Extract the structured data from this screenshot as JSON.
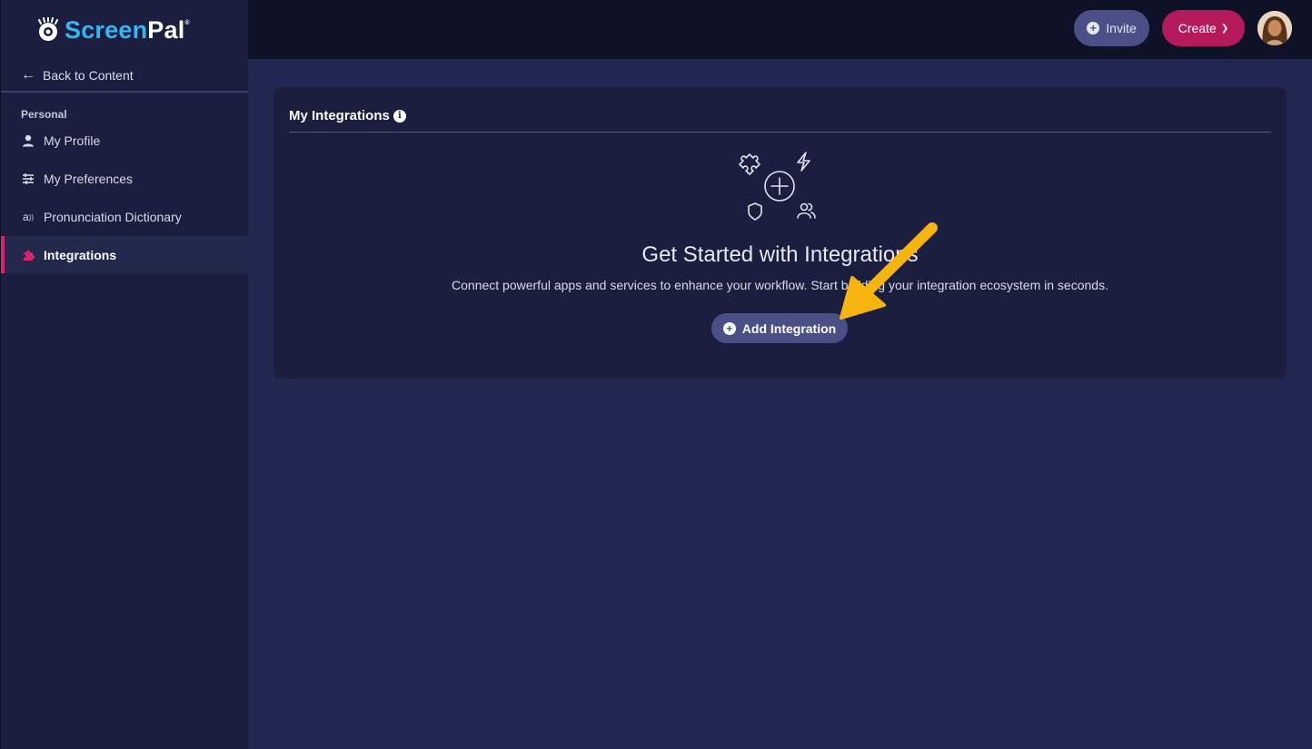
{
  "brand": {
    "name_part1": "Screen",
    "name_part2": "Pal",
    "mark": "®"
  },
  "sidebar": {
    "back_label": "Back to Content",
    "section_label": "Personal",
    "items": [
      {
        "label": "My Profile",
        "icon": "user-icon"
      },
      {
        "label": "My Preferences",
        "icon": "sliders-icon"
      },
      {
        "label": "Pronunciation Dictionary",
        "icon": "pronunciation-icon"
      },
      {
        "label": "Integrations",
        "icon": "puzzle-icon",
        "active": true
      }
    ]
  },
  "topbar": {
    "invite_label": "Invite",
    "create_label": "Create"
  },
  "card": {
    "title": "My Integrations",
    "empty_title": "Get Started with Integrations",
    "empty_desc": "Connect powerful apps and services to enhance your workflow. Start building your integration ecosystem in seconds.",
    "add_label": "Add Integration"
  },
  "colors": {
    "accent_pink": "#d8246a",
    "create_button": "#b41a5c",
    "pill_button": "#4a5085",
    "annotation_arrow": "#f6b40e",
    "logo_blue": "#35b6f4"
  }
}
